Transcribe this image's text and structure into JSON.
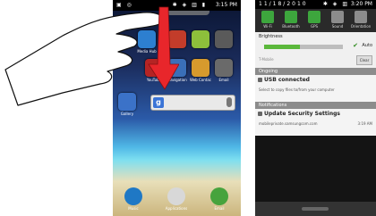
{
  "left_screen": {
    "status": {
      "left_icons": "▣ ◎",
      "right_icons": "✱ ◈ ▥ ▮",
      "time": "3:15 PM"
    },
    "apps": [
      {
        "label": "Media Hub",
        "color": "#2d7fd0"
      },
      {
        "label": "",
        "color": "#c33c2a"
      },
      {
        "label": "",
        "color": "#8dbf3b"
      },
      {
        "label": "",
        "color": "#5a5a5a"
      },
      {
        "label": "YouTube",
        "color": "#b52424"
      },
      {
        "label": "Navigation",
        "color": "#3a6fb8"
      },
      {
        "label": "Web Contacts",
        "color": "#d79a2d"
      },
      {
        "label": "Email",
        "color": "#6a6a6a"
      },
      {
        "label": "Gallery",
        "color": "#3b72c8"
      }
    ],
    "search": {
      "logo": "g"
    },
    "dock": [
      {
        "label": "Music",
        "color": "#1f78c5"
      },
      {
        "label": "Applications",
        "color": "#d8d8d8"
      },
      {
        "label": "Email",
        "color": "#47a33d"
      }
    ]
  },
  "right_screen": {
    "status": {
      "date": "11/18/2010",
      "right_icons": "✱ ◈ ▥",
      "time": "3:20 PM"
    },
    "toggles": [
      {
        "label": "Wi-Fi",
        "color": "#3da63d"
      },
      {
        "label": "Bluetooth",
        "color": "#3da63d"
      },
      {
        "label": "GPS",
        "color": "#3da63d"
      },
      {
        "label": "Sound",
        "color": "#8c8c8c"
      },
      {
        "label": "Orientation",
        "color": "#8c8c8c"
      }
    ],
    "brightness": {
      "title": "Brightness",
      "level": 0.45,
      "auto_label": "Auto",
      "clear_label": "Clear",
      "sub": "T-Mobile"
    },
    "sections": {
      "ongoing": "Ongoing",
      "notifications": "Notifications"
    },
    "usb": {
      "title": "USB connected",
      "body": "Select to copy files to/from your computer"
    },
    "update": {
      "title": "Update Security Settings",
      "body": "mobileprivate.samsungcom.com",
      "time": "3:19 AM"
    }
  },
  "colors": {
    "arrow": "#e8262b",
    "brightness_fill": "#5bb83b"
  }
}
